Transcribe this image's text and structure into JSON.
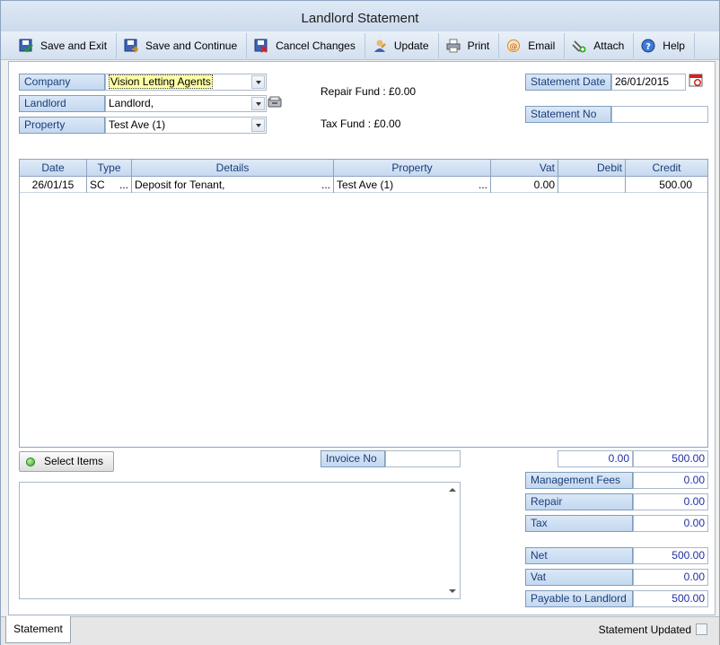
{
  "window": {
    "title": "Landlord Statement"
  },
  "toolbar": {
    "buttons": [
      {
        "label": "Save and Exit",
        "icon": "save-exit-icon"
      },
      {
        "label": "Save and Continue",
        "icon": "save-continue-icon"
      },
      {
        "label": "Cancel Changes",
        "icon": "cancel-changes-icon"
      },
      {
        "label": "Update",
        "icon": "update-icon"
      },
      {
        "label": "Print",
        "icon": "printer-icon"
      },
      {
        "label": "Email",
        "icon": "email-icon"
      },
      {
        "label": "Attach",
        "icon": "paperclip-icon"
      },
      {
        "label": "Help",
        "icon": "help-icon"
      }
    ]
  },
  "form": {
    "company_label": "Company",
    "company_value": "Vision Letting Agents",
    "landlord_label": "Landlord",
    "landlord_value": "Landlord,",
    "property_label": "Property",
    "property_value": "Test Ave (1)",
    "repair_fund": "Repair Fund : £0.00",
    "tax_fund": "Tax Fund : £0.00",
    "statement_date_label": "Statement Date",
    "statement_date_value": "26/01/2015",
    "statement_no_label": "Statement No",
    "statement_no_value": ""
  },
  "grid": {
    "columns": [
      "Date",
      "Type",
      "Details",
      "Property",
      "Vat",
      "Debit",
      "Credit"
    ],
    "rows": [
      {
        "date": "26/01/15",
        "type": "SC",
        "details": "Deposit for Tenant,",
        "property": "Test Ave (1)",
        "vat": "0.00",
        "debit": "",
        "credit": "500.00",
        "ellipsis": "..."
      }
    ]
  },
  "select_items_label": "Select Items",
  "invoice_no_label": "Invoice No",
  "invoice_no_value": "",
  "totals": {
    "debit_total": "0.00",
    "credit_total": "500.00",
    "management_fees_label": "Management Fees",
    "management_fees": "0.00",
    "repair_label": "Repair",
    "repair": "0.00",
    "tax_label": "Tax",
    "tax": "0.00",
    "net_label": "Net",
    "net": "500.00",
    "vat_label": "Vat",
    "vat": "0.00",
    "payable_label": "Payable to Landlord",
    "payable": "500.00"
  },
  "footer": {
    "tab_label": "Statement",
    "status_label": "Statement Updated"
  },
  "colors": {
    "label_bg": "#c3d8f0",
    "label_text": "#1a3d7a",
    "number_text": "#1f2fa8",
    "highlight": "#ffffa6"
  }
}
